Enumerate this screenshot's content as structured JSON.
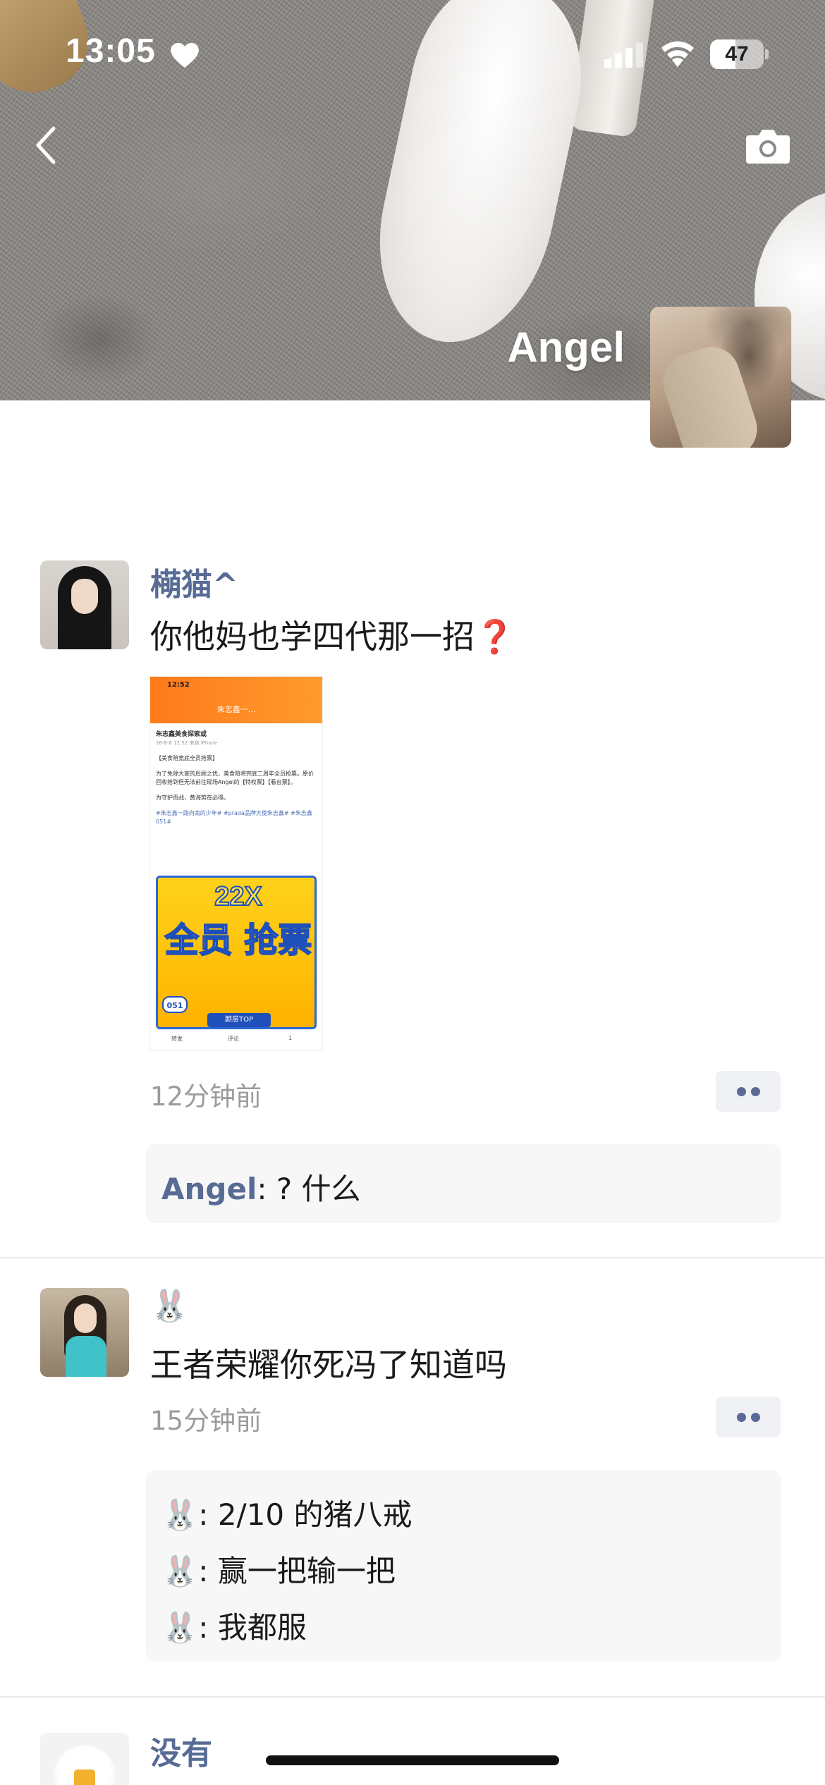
{
  "status_bar": {
    "time": "13:05",
    "battery_level": "47",
    "battery_fraction": 0.47
  },
  "cover": {
    "name": "Angel"
  },
  "icons": {
    "back": "chevron-left-icon",
    "camera": "camera-icon",
    "heart": "heart-icon",
    "more": "more-dots-icon"
  },
  "posts": [
    {
      "username": "橗猫^",
      "text": "你他妈也学四代那一招",
      "emoji": "❓",
      "time": "12分钟前",
      "image": {
        "status_time": "12:52",
        "title": "朱志鑫一...",
        "account_name": "朱志鑫美食探索或",
        "account_meta": "26-8-8 12:52 来自 iPhone",
        "line1": "【美食陪宽底全员抢票】",
        "line2": "为了免除大家的后顾之忧，美食陪将完底二周年全员抢票。原价回收抢到但无法前往现场Angel的【特权票】【看台票】。",
        "line3": "为守护而战，黄海势在必得。",
        "tags": "#朱志鑫一路向南的少年# #prada品牌大使朱志鑫# #朱志鑫051#",
        "poster_top": "22X",
        "poster_main": "全员 抢票",
        "poster_tag": "颜层TOP",
        "poster_num": "051",
        "footer_share": "转发",
        "footer_comment": "评论",
        "footer_like": "1"
      },
      "comments": [
        {
          "author": "Angel",
          "text": "? 什么"
        }
      ]
    },
    {
      "username": "🐰",
      "text": "王者荣耀你死冯了知道吗",
      "time": "15分钟前",
      "comments": [
        {
          "author": "🐰",
          "text": "2/10 的猪八戒"
        },
        {
          "author": "🐰",
          "text": "赢一把输一把"
        },
        {
          "author": "🐰",
          "text": "我都服"
        }
      ]
    },
    {
      "username": "没有"
    }
  ]
}
